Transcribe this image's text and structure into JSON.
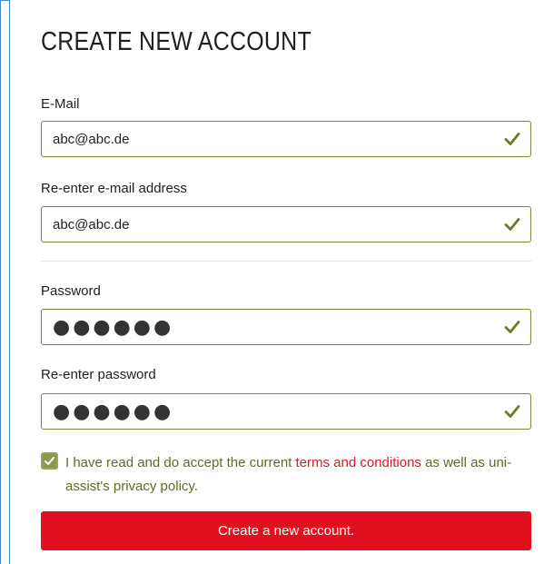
{
  "form": {
    "title": "CREATE NEW ACCOUNT",
    "email": {
      "label": "E-Mail",
      "value": "abc@abc.de",
      "valid": true
    },
    "email_confirm": {
      "label": "Re-enter e-mail address",
      "value": "abc@abc.de",
      "valid": true
    },
    "password": {
      "label": "Password",
      "masked_value": "●●●●●●",
      "valid": true
    },
    "password_confirm": {
      "label": "Re-enter password",
      "masked_value": "●●●●●●",
      "valid": true
    },
    "consent": {
      "checked": true,
      "text_before": "I have read and do accept the current ",
      "link_text": "terms and conditions",
      "text_after": " as well as uni-assist's privacy policy."
    },
    "submit_label": "Create a new account."
  },
  "colors": {
    "accent_red": "#e0101f",
    "link_red": "#d51a2a",
    "valid_green": "#6b7a2e",
    "field_border": "#7c8a3a",
    "frame_blue": "#4a86c8"
  },
  "icons": {
    "field_valid": "checkmark-icon",
    "consent_checkbox": "checkbox-checked-icon"
  }
}
